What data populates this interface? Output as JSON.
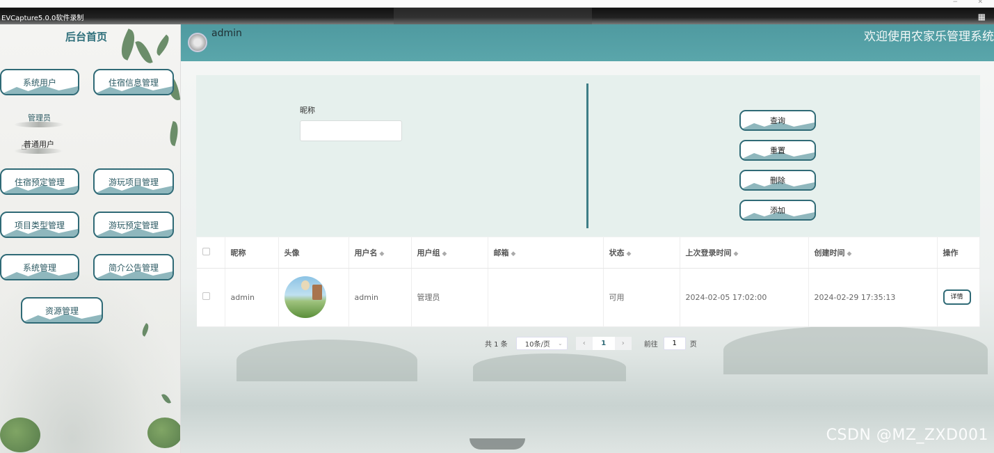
{
  "recorder": {
    "title": "EVCapture5.0.0软件录制"
  },
  "sidebar": {
    "title": "后台首页",
    "menu": [
      {
        "label": "系统用户"
      },
      {
        "label": "住宿信息管理"
      },
      {
        "label": "住宿预定管理"
      },
      {
        "label": "游玩项目管理"
      },
      {
        "label": "项目类型管理"
      },
      {
        "label": "游玩预定管理"
      },
      {
        "label": "系统管理"
      },
      {
        "label": "简介公告管理"
      },
      {
        "label": "资源管理"
      }
    ],
    "submenu": [
      {
        "label": "管理员"
      },
      {
        "label": "普通用户"
      }
    ]
  },
  "header": {
    "user": "admin",
    "welcome": "欢迎使用农家乐管理系统"
  },
  "search": {
    "nickname_label": "昵称",
    "nickname_value": ""
  },
  "actions": {
    "query": "查询",
    "reset": "重置",
    "delete": "删除",
    "add": "添加"
  },
  "table": {
    "headers": {
      "nickname": "昵称",
      "avatar": "头像",
      "username": "用户名",
      "group": "用户组",
      "email": "邮箱",
      "status": "状态",
      "last_login": "上次登录时间",
      "created": "创建时间",
      "ops": "操作"
    },
    "rows": [
      {
        "nickname": "admin",
        "username": "admin",
        "group": "管理员",
        "email": "",
        "status": "可用",
        "last_login": "2024-02-05 17:02:00",
        "created": "2024-02-29 17:35:13",
        "detail": "详情"
      }
    ]
  },
  "pagination": {
    "total": "共 1 条",
    "page_size": "10条/页",
    "current": "1",
    "goto_label": "前往",
    "goto_value": "1",
    "page_suffix": "页"
  },
  "watermark": "CSDN @MZ_ZXD001",
  "colors": {
    "header": "#5aa6ab",
    "accent": "#2f6a76",
    "panel": "#e6f0ed"
  }
}
